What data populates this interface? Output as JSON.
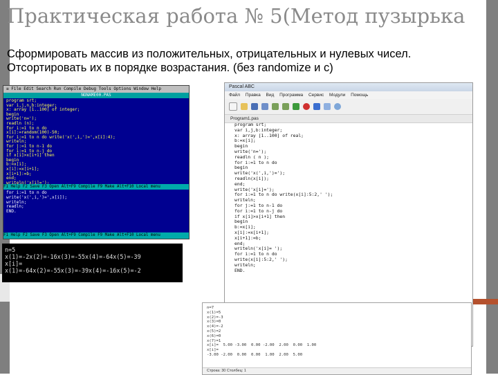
{
  "slide": {
    "title": "Практическая работа № 5(Метод пузырька",
    "subtitle_line1": "Сформировать массив из положительных, отрицательных и нулевых чисел.",
    "subtitle_line2": "Отсортировать их в порядке возрастания. (без randomize  и с)"
  },
  "turbo_pascal": {
    "menu": "≡  File  Edit  Search  Run  Compile  Debug  Tools  Options  Window  Help",
    "frame_title": "NONAME00.PAS",
    "code": "program srt;\nvar i,j,n,b:integer;\nx: array [1..100] of integer;\nbegin\nwrite('n=');\nreadln (n);\nfor i:=1 to n do\nx[i]:=random(100)-50;\nfor i:=1 to n do write('x(',i,')=',x[i]:4);\nwriteln;\nfor j:=1 to n-1 do\nfor i:=1 to n-j do\nif x[i]>x[i+1] then\nbegin\nb:=x[i];\nx[i]:=x[i+1];\nx[i+1]:=b;\nend;\nwriteln('x[i]=');",
    "status": "F1 Help  F2 Save  F3 Open  Alt+F9 Compile  F9 Make  Alt+F10 Local menu",
    "code2": "for i:=1 to n do\nwrite('x(',i,')=',x[i]);\nwriteln;\nreadln;\nEND.",
    "bottom": " 28:1 ",
    "bottom_keys": "F1 Help  F2 Save  F3 Open  Alt+F9 Compile  F9 Make  Alt+F10 Local menu"
  },
  "console": {
    "lines": "n=5\nx(1)=-2x(2)=-16x(3)=-55x(4)=-64x(5)=-39\nx[i]=\nx(1)=-64x(2)=-55x(3)=-39x(4)=-16x(5)=-2"
  },
  "pascal_abc": {
    "title": "Pascal ABC",
    "menu": "Файл Правка Вид Программа Сервис Модули Помощь",
    "tab": "Program1.pas",
    "code": "program srt;\nvar i,j,b:integer;\nx: array [1..100] of real;\nb:=x[i];\nbegin\nwrite('n=');\nreadln ( n );\nfor i:=1 to n do\nbegin\nwrite('x(',i,')=');\nreadln(x[i]);\nend;\nwrite('x[i]=');\nfor i:=1 to n do write(x[i]:5:2,' ');\nwriteln;\nfor j:=1 to n-1 do\nfor i:=1 to n-j do\nif x[i]>x[i+1] then\nbegin\nb:=x[i];\nx[i]:=x[i+1];\nx[i+1]:=b;\nend;\nwriteln('x[i]= ');\nfor i:=1 to n do\nwrite(x[i]:5:2,' ');\nwriteln;\nEND."
  },
  "output": {
    "lines": "n=7\nx(1)=5\nx(2)=-3\nx(3)=0\nx(4)=-2\nx(5)=2\nx(6)=0\nx(7)=1\nx[i]=  5.00 -3.00  0.00 -2.00  2.00  0.00  1.00\nx[i]=\n-3.00 -2.00  0.00  0.00  1.00  2.00  5.00",
    "status": "Строка: 30  Столбец: 1"
  }
}
